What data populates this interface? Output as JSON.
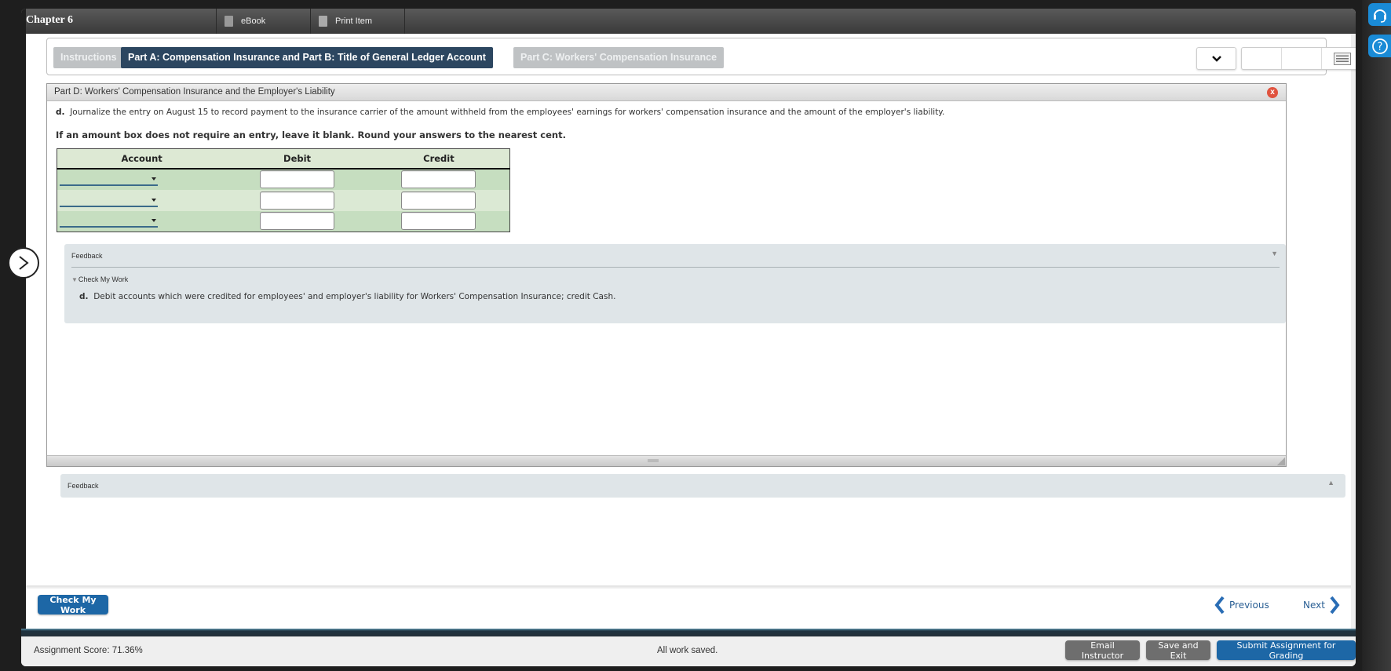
{
  "header": {
    "chapter": "Chapter 6",
    "ebook_label": "eBook",
    "print_label": "Print Item"
  },
  "tabs": [
    {
      "label": "Instructions",
      "state": "inactive"
    },
    {
      "label": "Part A: Compensation Insurance and Part B: Title of General Ledger Account",
      "state": "active"
    },
    {
      "label": "Part C: Workers' Compensation Insurance",
      "state": "inactive"
    }
  ],
  "panel": {
    "title": "Part D: Workers' Compensation Insurance and the Employer's Liability",
    "question_letter": "d.",
    "question_text": "Journalize the entry on August 15 to record payment to the insurance carrier of the amount withheld from the employees' earnings for workers' compensation insurance and the amount of the employer's liability.",
    "instruction": "If an amount box does not require an entry, leave it blank. Round your answers to the nearest cent.",
    "table": {
      "headers": [
        "Account",
        "Debit",
        "Credit"
      ],
      "rows": [
        {
          "account": "",
          "debit": "",
          "credit": ""
        },
        {
          "account": "",
          "debit": "",
          "credit": ""
        },
        {
          "account": "",
          "debit": "",
          "credit": ""
        }
      ]
    },
    "feedback": {
      "label": "Feedback",
      "check_label": "Check My Work",
      "letter": "d.",
      "text": "Debit accounts which were credited for employees' and employer's liability for Workers' Compensation Insurance; credit Cash."
    }
  },
  "bottom_feedback": {
    "label": "Feedback"
  },
  "footer": {
    "check_button": "Check My Work",
    "previous": "Previous",
    "next": "Next"
  },
  "statusbar": {
    "score": "Assignment Score: 71.36%",
    "saved": "All work saved.",
    "email": "Email Instructor",
    "save_exit": "Save and Exit",
    "submit": "Submit Assignment for Grading"
  },
  "colors": {
    "active_tab": "#2c4660",
    "primary_button": "#1d67a6",
    "side_button": "#1a8bd6",
    "close": "#e0533f"
  }
}
